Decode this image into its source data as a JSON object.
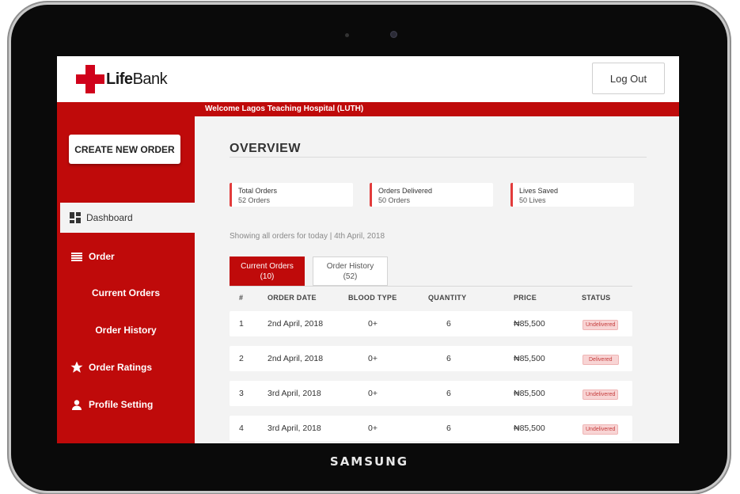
{
  "device": {
    "brand": "SAMSUNG"
  },
  "header": {
    "logo_text_bold": "Life",
    "logo_text_regular": "Bank",
    "logout_label": "Log Out"
  },
  "welcome": "Welcome Lagos Teaching Hospital (LUTH)",
  "sidebar": {
    "create_label": "CREATE NEW ORDER",
    "dashboard_label": "Dashboard",
    "order_label": "Order",
    "current_orders_label": "Current Orders",
    "order_history_label": "Order History",
    "order_ratings_label": "Order Ratings",
    "profile_label": "Profile Setting"
  },
  "overview": {
    "title": "OVERVIEW",
    "stats": [
      {
        "label": "Total Orders",
        "value": "52 Orders"
      },
      {
        "label": "Orders Delivered",
        "value": "50 Orders"
      },
      {
        "label": "Lives Saved",
        "value": "50 Lives"
      }
    ],
    "showing": "Showing all orders for today | 4th April, 2018"
  },
  "tabs": [
    {
      "label": "Current Orders",
      "count": "(10)"
    },
    {
      "label": "Order History",
      "count": "(52)"
    }
  ],
  "table": {
    "headers": [
      "#",
      "ORDER DATE",
      "BLOOD TYPE",
      "QUANTITY",
      "PRICE",
      "STATUS"
    ],
    "rows": [
      [
        "1",
        "2nd April, 2018",
        "0+",
        "6",
        "₦85,500",
        "Undelivered"
      ],
      [
        "2",
        "2nd April, 2018",
        "0+",
        "6",
        "₦85,500",
        "Delivered"
      ],
      [
        "3",
        "3rd April, 2018",
        "0+",
        "6",
        "₦85,500",
        "Undelivered"
      ],
      [
        "4",
        "3rd April, 2018",
        "0+",
        "6",
        "₦85,500",
        "Undelivered"
      ]
    ]
  },
  "colors": {
    "brand_red": "#bf0a0a",
    "accent": "#e23b3b",
    "badge_bg": "#f8d4d4"
  }
}
